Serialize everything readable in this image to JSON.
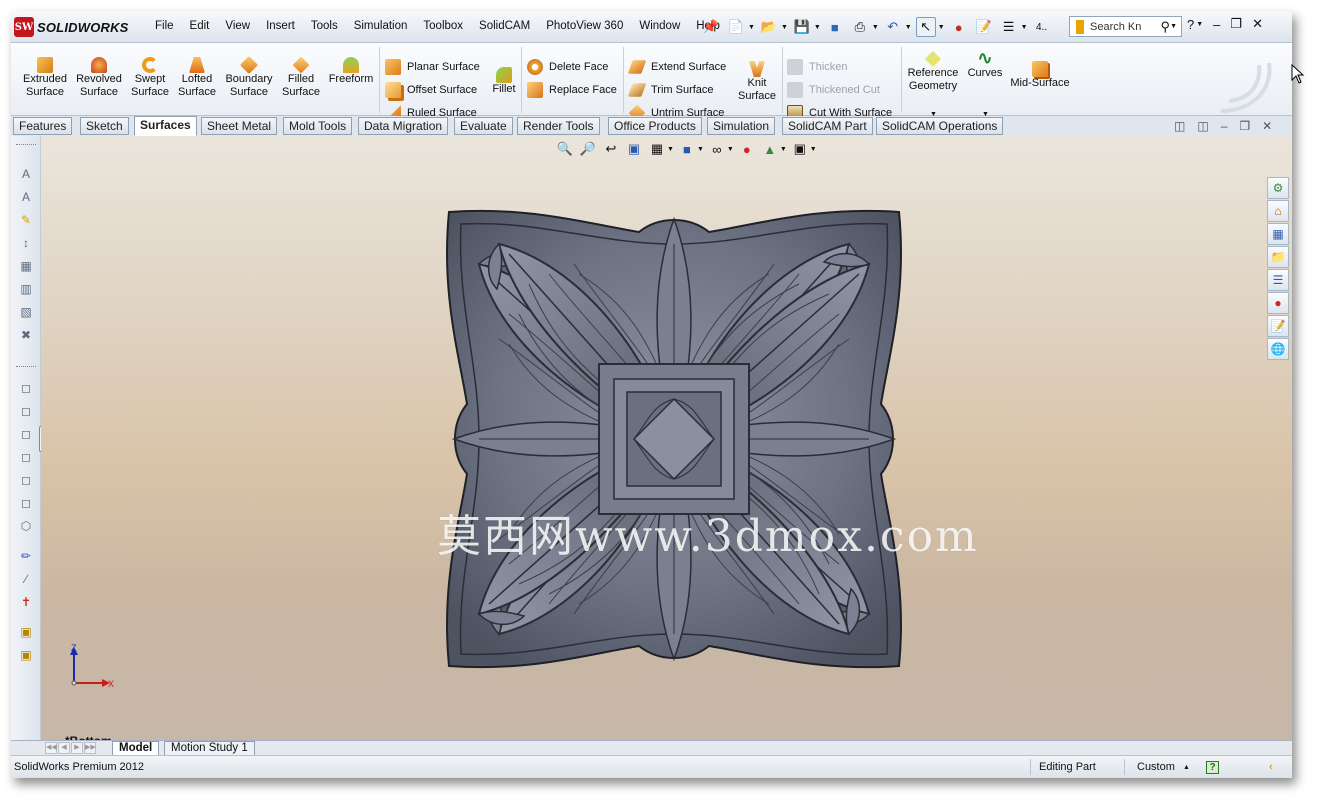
{
  "app": {
    "logo_text": "SOLIDWORKS",
    "logo_mark": "SW",
    "product": "SolidWorks Premium 2012"
  },
  "menu": [
    "File",
    "Edit",
    "View",
    "Insert",
    "Tools",
    "Simulation",
    "Toolbox",
    "SolidCAM",
    "PhotoView 360",
    "Window",
    "Help"
  ],
  "search": {
    "placeholder": "Search Kn"
  },
  "ribbon": {
    "extruded": "Extruded\nSurface",
    "revolved": "Revolved\nSurface",
    "swept": "Swept\nSurface",
    "lofted": "Lofted\nSurface",
    "boundary": "Boundary\nSurface",
    "filled": "Filled\nSurface",
    "freeform": "Freeform",
    "planar": "Planar Surface",
    "offset": "Offset Surface",
    "ruled": "Ruled Surface",
    "fillet": "Fillet",
    "delete_face": "Delete Face",
    "replace_face": "Replace Face",
    "extend": "Extend Surface",
    "trim": "Trim Surface",
    "untrim": "Untrim Surface",
    "knit": "Knit\nSurface",
    "thicken": "Thicken",
    "thickened_cut": "Thickened Cut",
    "cut_with_surface": "Cut With Surface",
    "reference_geometry": "Reference\nGeometry",
    "curves": "Curves",
    "mid_surface": "Mid-Surface"
  },
  "tabs": [
    "Features",
    "Sketch",
    "Surfaces",
    "Sheet Metal",
    "Mold Tools",
    "Data Migration",
    "Evaluate",
    "Render Tools",
    "Office Products",
    "Simulation",
    "SolidCAM Part",
    "SolidCAM Operations"
  ],
  "active_tab": "Surfaces",
  "viewport": {
    "view_name": "*Bottom",
    "watermark": "莫西网www.3dmox.com",
    "triad": {
      "z": "Z",
      "x": "X"
    }
  },
  "bottom_tabs": [
    "Model",
    "Motion Study 1"
  ],
  "status": {
    "mode": "Editing Part",
    "units": "Custom",
    "help": "?"
  },
  "colors": {
    "model": "#6d7383",
    "model_edge": "#2a2d35",
    "accent_red": "#c4161c"
  }
}
